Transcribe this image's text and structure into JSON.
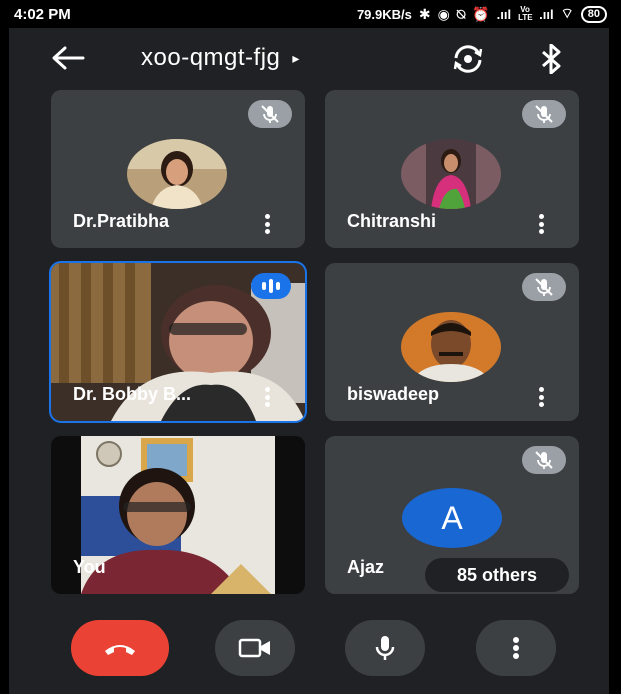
{
  "status_bar": {
    "time": "4:02 PM",
    "net_speed": "79.9KB/s",
    "signal1": ".ııl",
    "volte": "Vo LTE",
    "signal2": ".ııl",
    "battery": "80"
  },
  "header": {
    "meeting_code": "xoo-qmgt-fjg",
    "caret": "▸"
  },
  "participants": [
    {
      "name": "Dr.Pratibha",
      "muted": true,
      "type": "avatar"
    },
    {
      "name": "Chitranshi",
      "muted": true,
      "type": "avatar"
    },
    {
      "name": "Dr. Bobby B...",
      "muted": false,
      "speaking": true,
      "type": "video"
    },
    {
      "name": "biswadeep",
      "muted": true,
      "type": "avatar"
    },
    {
      "name": "You",
      "type": "video"
    },
    {
      "name": "Ajaz",
      "muted": true,
      "type": "letter",
      "initial": "A",
      "others_label": "85 others"
    }
  ],
  "colors": {
    "end_call": "#ea4335",
    "speaking_blue": "#1a73e8",
    "letter_avatar": "#1967d2",
    "tile_bg": "#3c4043",
    "app_bg": "#202124"
  },
  "controls": [
    "end-call",
    "camera",
    "microphone",
    "more-options"
  ]
}
